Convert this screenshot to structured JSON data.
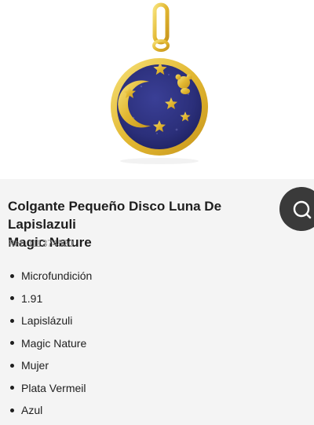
{
  "product": {
    "title_line1": "Colgante Pequeño Disco Luna De Lapislazuli",
    "title_line2": "Magic Nature",
    "ref": "Ref. 111374520",
    "features": [
      "Microfundición",
      "1.91",
      "Lapislázuli",
      "Magic Nature",
      "Mujer",
      "Plata Vermeil",
      "Azul"
    ]
  },
  "icons": {
    "search": "search-icon",
    "moon": "moon-icon",
    "star": "star-icon",
    "bear": "bear-icon"
  },
  "colors": {
    "gold": "#e8c23c",
    "lapis": "#2b2f7a",
    "fab": "#3a3a3a",
    "text": "#1e1e1e",
    "muted": "#8a8a8a"
  }
}
